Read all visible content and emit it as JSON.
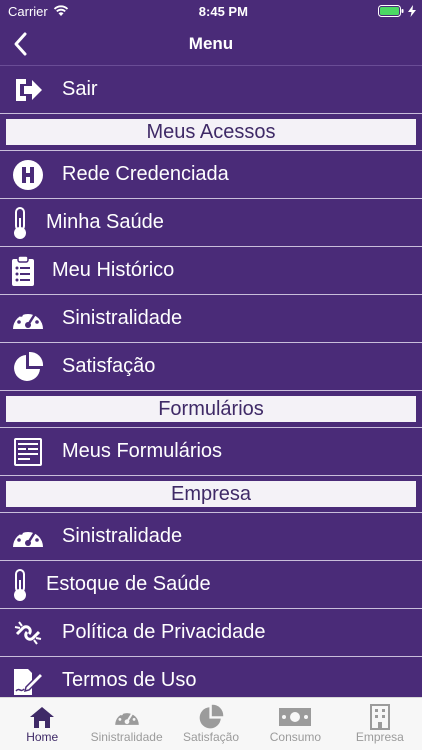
{
  "status": {
    "carrier": "Carrier",
    "time": "8:45 PM"
  },
  "nav": {
    "title": "Menu"
  },
  "logout": {
    "label": "Sair"
  },
  "sections": {
    "acessos": "Meus Acessos",
    "formularios": "Formulários",
    "empresa": "Empresa"
  },
  "acessos_items": [
    {
      "label": "Rede Credenciada",
      "icon": "hospital-icon"
    },
    {
      "label": "Minha Saúde",
      "icon": "thermometer-icon"
    },
    {
      "label": "Meu Histórico",
      "icon": "clipboard-icon"
    },
    {
      "label": "Sinistralidade",
      "icon": "gauge-icon"
    },
    {
      "label": "Satisfação",
      "icon": "pie-chart-icon"
    }
  ],
  "formularios_items": [
    {
      "label": "Meus Formulários",
      "icon": "form-icon"
    }
  ],
  "empresa_items": [
    {
      "label": "Sinistralidade",
      "icon": "gauge-icon"
    },
    {
      "label": "Estoque de Saúde",
      "icon": "thermometer-icon"
    },
    {
      "label": "Política de Privacidade",
      "icon": "broken-link-icon"
    },
    {
      "label": "Termos de Uso",
      "icon": "signature-icon"
    }
  ],
  "tabs": [
    {
      "label": "Home",
      "icon": "home-icon",
      "active": true
    },
    {
      "label": "Sinistralidade",
      "icon": "gauge-icon",
      "active": false
    },
    {
      "label": "Satisfação",
      "icon": "pie-chart-icon",
      "active": false
    },
    {
      "label": "Consumo",
      "icon": "money-icon",
      "active": false
    },
    {
      "label": "Empresa",
      "icon": "building-icon",
      "active": false
    }
  ],
  "colors": {
    "background": "#4a2b78",
    "section_text": "#3f2a67",
    "active_tab": "#3f2a67"
  }
}
